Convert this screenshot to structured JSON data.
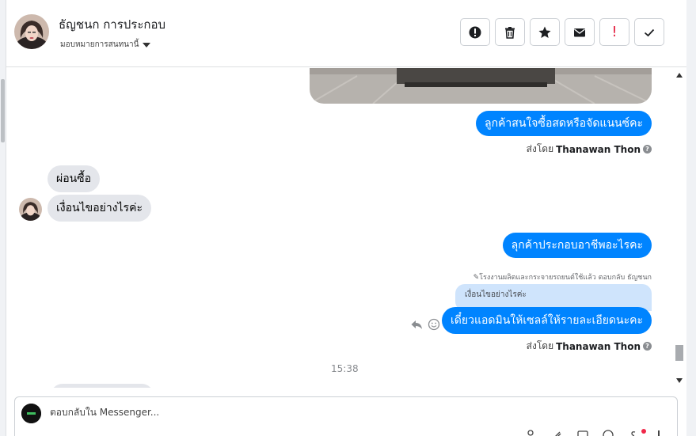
{
  "header": {
    "contact_name": "ธัญชนก การประกอบ",
    "assign_label": "มอบหมายการสนทนานี้"
  },
  "actions": [
    {
      "name": "report-spam-icon",
      "color": "#1c1e21"
    },
    {
      "name": "trash-icon",
      "color": "#1c1e21"
    },
    {
      "name": "star-icon",
      "color": "#1c1e21"
    },
    {
      "name": "envelope-icon",
      "color": "#1c1e21"
    },
    {
      "name": "exclamation-icon",
      "color": "#e41e3f",
      "glyph": "!"
    },
    {
      "name": "check-icon",
      "color": "#1c1e21"
    }
  ],
  "messages": {
    "m1": "ลูกค้าสนใจซื้อสดหรือจัดแนนซ์คะ",
    "sent_by_prefix": "ส่งโดย",
    "sent_by_name": "Thanawan Thon",
    "in1": "ผ่อนซื้อ",
    "in2": "เงื่อนไขอย่างไรค่ะ",
    "m2": "ลุกค้าประกอบอาชีพอะไรคะ",
    "reply_note": "โรงงานผลิตและกระจายรถยนต์ใช้แล้ว ตอบกลับ ธัญชนก",
    "reply_quote": "เงื่อนไขอย่างไรค่ะ",
    "m3": "เดี๋ยวแอดมินให้เซลล์ให้รายละเอียดนะคะ",
    "time": "15:38"
  },
  "composer": {
    "placeholder": "ตอบกลับใน Messenger..."
  },
  "colors": {
    "brand_blue": "#0084ff",
    "incoming_gray": "#e4e6eb",
    "quote_blue": "#cfe4fc"
  }
}
